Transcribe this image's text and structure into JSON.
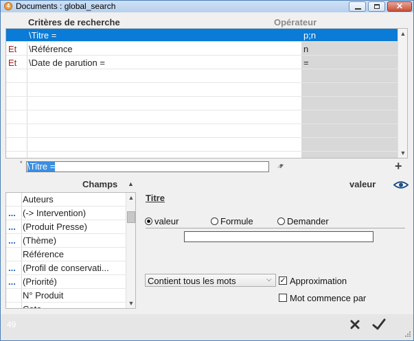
{
  "window": {
    "title": "Documents : global_search",
    "app_icon": "4d-app-icon"
  },
  "criteria": {
    "header_criteria": "Critères de recherche",
    "header_operator": "Opérateur",
    "rows": [
      {
        "conj": "",
        "criterion": "\\Titre =",
        "operator": "p;n",
        "selected": true
      },
      {
        "conj": "Et",
        "criterion": "\\Référence",
        "operator": "n",
        "selected": false
      },
      {
        "conj": "Et",
        "criterion": "\\Date de parution =",
        "operator": "=",
        "selected": false
      },
      {
        "conj": "",
        "criterion": "",
        "operator": "",
        "selected": false
      },
      {
        "conj": "",
        "criterion": "",
        "operator": "",
        "selected": false
      },
      {
        "conj": "",
        "criterion": "",
        "operator": "",
        "selected": false
      },
      {
        "conj": "",
        "criterion": "",
        "operator": "",
        "selected": false
      },
      {
        "conj": "",
        "criterion": "",
        "operator": "",
        "selected": false
      },
      {
        "conj": "",
        "criterion": "",
        "operator": "",
        "selected": false
      }
    ]
  },
  "editor": {
    "marker": "*",
    "value": "\\Titre ="
  },
  "fields": {
    "header": "Champs",
    "items": [
      {
        "dots": "",
        "label": "Auteurs"
      },
      {
        "dots": "...",
        "label": "(-> Intervention)"
      },
      {
        "dots": "...",
        "label": "(Produit Presse)"
      },
      {
        "dots": "...",
        "label": "(Thème)"
      },
      {
        "dots": "",
        "label": "Référence"
      },
      {
        "dots": "...",
        "label": "(Profil de conservati..."
      },
      {
        "dots": "...",
        "label": "(Priorité)"
      },
      {
        "dots": "",
        "label": "N° Produit"
      },
      {
        "dots": "",
        "label": "Cote"
      }
    ]
  },
  "detail": {
    "value_header": "valeur",
    "title": "Titre",
    "radios": [
      {
        "label": "valeur",
        "checked": true
      },
      {
        "label": "Formule",
        "checked": false
      },
      {
        "label": "Demander",
        "checked": false
      }
    ],
    "value_input": "",
    "match_mode": "Contient tous les mots",
    "approximation_label": "Approximation",
    "approximation_checked": true,
    "starts_with_label": "Mot commence par",
    "starts_with_checked": false
  },
  "status": {
    "count": "49"
  },
  "colors": {
    "selection": "#0a7bd6",
    "conjunction": "#9b1c1c",
    "operator_column": "#d8d8d8"
  }
}
